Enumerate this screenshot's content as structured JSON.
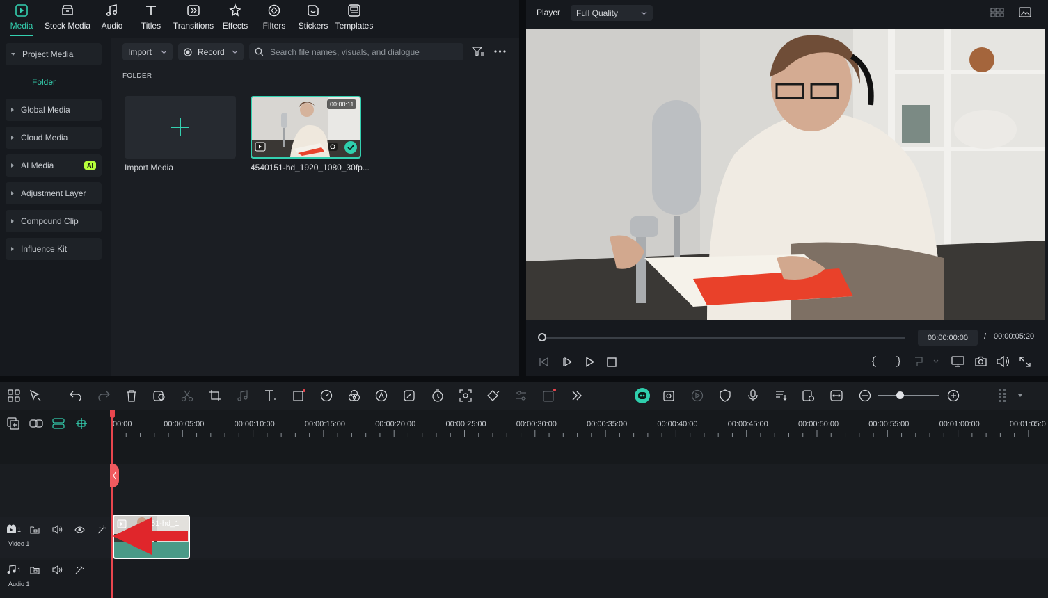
{
  "top_tabs": [
    {
      "label": "Media",
      "icon": "media-icon",
      "active": true
    },
    {
      "label": "Stock Media",
      "icon": "stock-media-icon"
    },
    {
      "label": "Audio",
      "icon": "audio-note-icon"
    },
    {
      "label": "Titles",
      "icon": "titles-icon"
    },
    {
      "label": "Transitions",
      "icon": "transitions-icon"
    },
    {
      "label": "Effects",
      "icon": "effects-icon"
    },
    {
      "label": "Filters",
      "icon": "filters-icon"
    },
    {
      "label": "Stickers",
      "icon": "stickers-icon"
    },
    {
      "label": "Templates",
      "icon": "templates-icon"
    }
  ],
  "sidebar": {
    "items": [
      {
        "label": "Project Media",
        "expanded": true
      },
      {
        "label": "Folder",
        "child": true
      },
      {
        "label": "Global Media"
      },
      {
        "label": "Cloud Media"
      },
      {
        "label": "AI Media",
        "badge": "AI"
      },
      {
        "label": "Adjustment Layer"
      },
      {
        "label": "Compound Clip"
      },
      {
        "label": "Influence Kit"
      }
    ]
  },
  "media": {
    "import_label": "Import",
    "record_label": "Record",
    "search_placeholder": "Search file names, visuals, and dialogue",
    "folder_heading": "FOLDER",
    "import_media_label": "Import Media",
    "clip": {
      "name": "4540151-hd_1920_1080_30fp...",
      "duration": "00:00:11"
    }
  },
  "player": {
    "label": "Player",
    "quality": "Full Quality",
    "current_time": "00:00:00:00",
    "separator": "/",
    "total_time": "00:00:05:20",
    "progress": 0
  },
  "timeline": {
    "ruler": [
      "00:00",
      "00:00:05:00",
      "00:00:10:00",
      "00:00:15:00",
      "00:00:20:00",
      "00:00:25:00",
      "00:00:30:00",
      "00:00:35:00",
      "00:00:40:00",
      "00:00:45:00",
      "00:00:50:00",
      "00:00:55:00",
      "00:01:00:00",
      "00:01:05:0"
    ],
    "tracks": [
      {
        "name": "Video 1",
        "index": "1"
      },
      {
        "name": "Audio 1",
        "index": "1"
      }
    ],
    "clip_label": "51-hd_1",
    "zoom": 0.35
  },
  "colors": {
    "accent": "#34d0b0",
    "playhead": "#e8464e",
    "arrow": "#e0262b"
  }
}
